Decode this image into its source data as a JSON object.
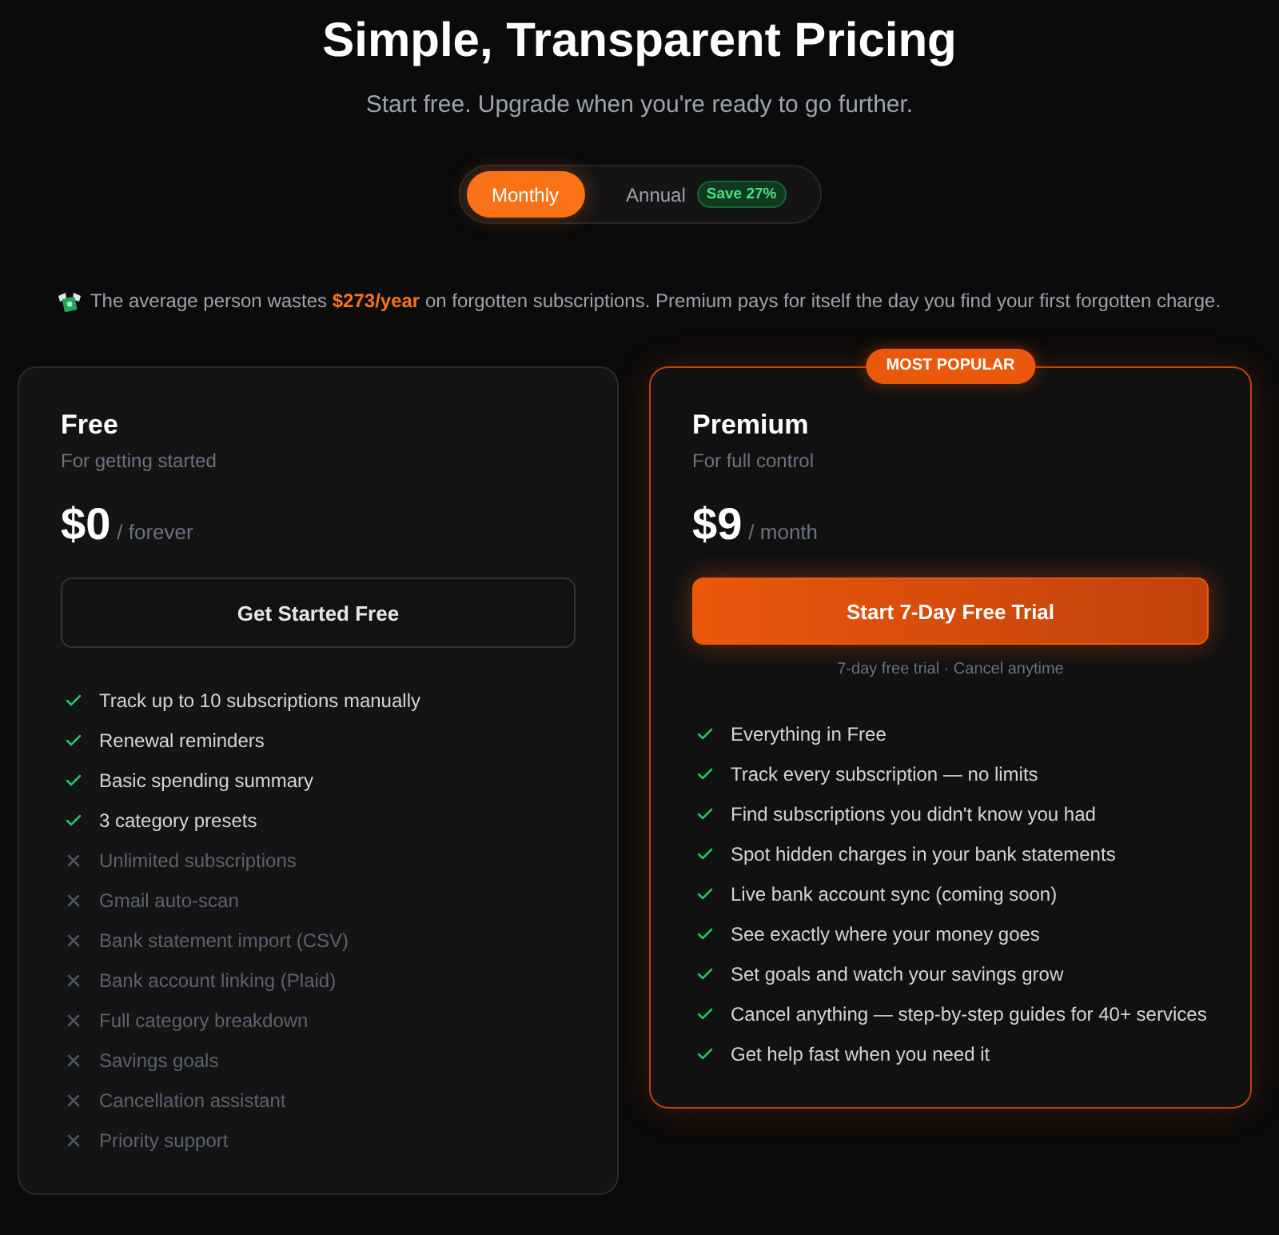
{
  "header": {
    "title": "Simple, Transparent Pricing",
    "subtitle": "Start free. Upgrade when you're ready to go further."
  },
  "billing_toggle": {
    "options": [
      {
        "label": "Monthly",
        "selected": true
      },
      {
        "label": "Annual",
        "selected": false,
        "badge": "Save 27%"
      }
    ]
  },
  "savings_note": {
    "text": "The average person wastes **$273/year** on forgotten subscriptions. Premium pays for itself the day you find your first forgotten charge."
  },
  "plans": [
    {
      "name": "Free",
      "tagline": "For getting started",
      "price": "$0",
      "period": "/ forever",
      "highlighted": false,
      "button": {
        "label": "Get Started Free",
        "kind": "outline"
      },
      "features": [
        {
          "text": "Track up to 10 subscriptions manually",
          "included": true
        },
        {
          "text": "Renewal reminders",
          "included": true
        },
        {
          "text": "Basic spending summary",
          "included": true
        },
        {
          "text": "3 category presets",
          "included": true
        },
        {
          "text": "Unlimited subscriptions",
          "included": false
        },
        {
          "text": "Gmail auto-scan",
          "included": false
        },
        {
          "text": "Bank statement import (CSV)",
          "included": false
        },
        {
          "text": "Bank account linking (Plaid)",
          "included": false
        },
        {
          "text": "Full category breakdown",
          "included": false
        },
        {
          "text": "Savings goals",
          "included": false
        },
        {
          "text": "Cancellation assistant",
          "included": false
        },
        {
          "text": "Priority support",
          "included": false
        }
      ]
    },
    {
      "name": "Premium",
      "badge": "MOST POPULAR",
      "tagline": "For full control",
      "price": "$9",
      "period": "/ month",
      "highlighted": true,
      "button": {
        "label": "Start 7-Day Free Trial",
        "kind": "primary"
      },
      "button_note": "7-day free trial · Cancel anytime",
      "features": [
        {
          "text": "Everything in Free",
          "included": true
        },
        {
          "text": "Track every subscription — no limits",
          "included": true
        },
        {
          "text": "Find subscriptions you didn't know you had",
          "included": true
        },
        {
          "text": "Spot hidden charges in your bank statements",
          "included": true
        },
        {
          "text": "Live bank account sync (coming soon)",
          "included": true
        },
        {
          "text": "See exactly where your money goes",
          "included": true
        },
        {
          "text": "Set goals and watch your savings grow",
          "included": true
        },
        {
          "text": "Cancel anything — step-by-step guides for 40+ services",
          "included": true
        },
        {
          "text": "Get help fast when you need it",
          "included": true
        }
      ]
    }
  ]
}
